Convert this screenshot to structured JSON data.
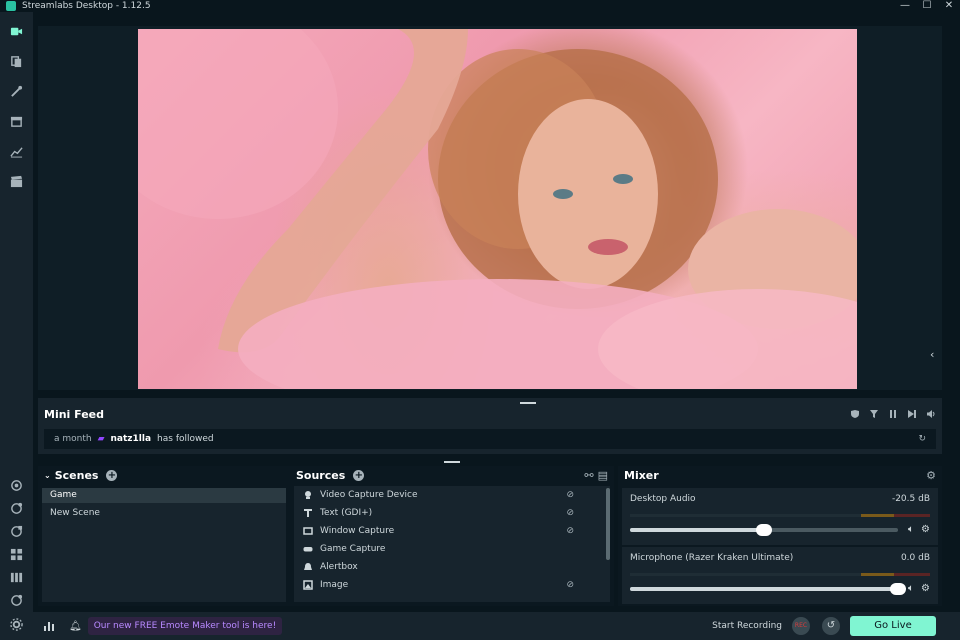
{
  "window": {
    "title": "Streamlabs Desktop - 1.12.5",
    "minimize": "—",
    "maximize": "☐",
    "close": "✕"
  },
  "nav": {
    "items": [
      "studio-icon",
      "themes-icon",
      "editor-icon",
      "store-icon",
      "analytics-icon",
      "clapper-icon"
    ],
    "bottom_items": [
      "highlighter-icon",
      "dashboard-icon",
      "layout-icon",
      "grid-icon",
      "columns-icon",
      "help-icon",
      "settings-icon"
    ]
  },
  "mini_feed": {
    "title": "Mini Feed",
    "event": {
      "time": "a month",
      "platform_icon": "twitch-icon",
      "user": "natz1lla",
      "action": "has followed"
    }
  },
  "scenes": {
    "title": "Scenes",
    "add": "+",
    "items": [
      {
        "label": "Game",
        "active": true
      },
      {
        "label": "New Scene",
        "active": false
      }
    ]
  },
  "sources": {
    "title": "Sources",
    "add": "+",
    "items": [
      {
        "label": "Video Capture Device",
        "icon": "webcam-icon",
        "hidden": true
      },
      {
        "label": "Text (GDI+)",
        "icon": "text-icon",
        "hidden": true
      },
      {
        "label": "Window Capture",
        "icon": "window-icon",
        "hidden": true
      },
      {
        "label": "Game Capture",
        "icon": "gamepad-icon",
        "hidden": false
      },
      {
        "label": "Alertbox",
        "icon": "bell-icon",
        "hidden": false
      },
      {
        "label": "Image",
        "icon": "image-icon",
        "hidden": true
      }
    ]
  },
  "mixer": {
    "title": "Mixer",
    "channels": [
      {
        "name": "Desktop Audio",
        "db": "-20.5 dB",
        "volume": 0.5
      },
      {
        "name": "Microphone (Razer Kraken Ultimate)",
        "db": "0.0 dB",
        "volume": 1.0
      }
    ]
  },
  "footer": {
    "promo": "Our new FREE Emote Maker tool is here!",
    "record_label": "Start Recording",
    "rec_button": "REC",
    "go_live": "Go Live"
  },
  "colors": {
    "accent": "#80f5d2",
    "promo_text": "#b889ff",
    "twitch": "#9146ff"
  }
}
